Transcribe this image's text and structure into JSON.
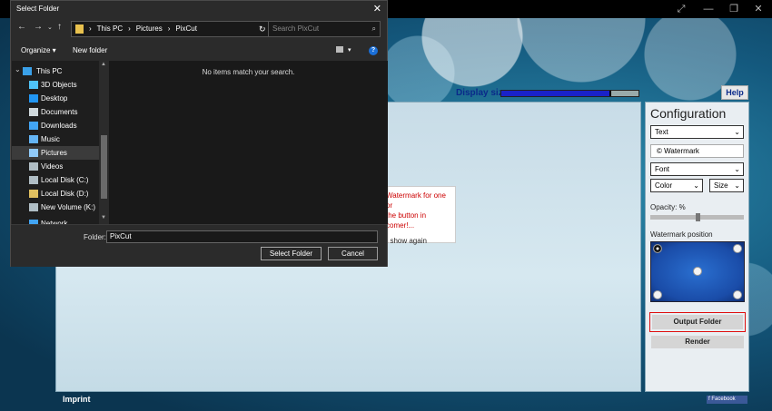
{
  "app": {
    "display_size_label": "Display size:",
    "display_size_value": 0.8,
    "help_label": "Help",
    "imprint_label": "Imprint",
    "facebook_label": "f Facebook",
    "notice": {
      "line1": "Watermark for one or",
      "line2": "the button in",
      "line3": "comer!...",
      "line4": "t show again"
    }
  },
  "config": {
    "title": "Configuration",
    "type_select": "Text",
    "watermark_text": "© Watermark",
    "font_select": "Font",
    "color_select": "Color",
    "size_select": "Size",
    "opacity_label": "Opacity: %",
    "opacity_value": 0.5,
    "position_label": "Watermark position",
    "output_folder_label": "Output Folder",
    "render_label": "Render"
  },
  "dialog": {
    "title": "Select Folder",
    "breadcrumb": [
      "This PC",
      "Pictures",
      "PixCut"
    ],
    "search_placeholder": "Search PixCut",
    "organize_label": "Organize ▾",
    "new_folder_label": "New folder",
    "nav_items": [
      {
        "label": "This PC",
        "icon": "computer-icon",
        "color": "#3aa0e8"
      },
      {
        "label": "3D Objects",
        "icon": "cube-icon",
        "color": "#4fc3f7"
      },
      {
        "label": "Desktop",
        "icon": "desktop-icon",
        "color": "#2196f3"
      },
      {
        "label": "Documents",
        "icon": "document-icon",
        "color": "#cfd8dc"
      },
      {
        "label": "Downloads",
        "icon": "download-icon",
        "color": "#42a5f5"
      },
      {
        "label": "Music",
        "icon": "music-icon",
        "color": "#64b5f6"
      },
      {
        "label": "Pictures",
        "icon": "picture-icon",
        "color": "#90caf9"
      },
      {
        "label": "Videos",
        "icon": "video-icon",
        "color": "#b0bec5"
      },
      {
        "label": "Local Disk (C:)",
        "icon": "drive-icon",
        "color": "#b0bec5"
      },
      {
        "label": "Local Disk (D:)",
        "icon": "drive-icon",
        "color": "#e0c060"
      },
      {
        "label": "New Volume (K:)",
        "icon": "drive-icon",
        "color": "#b0bec5"
      },
      {
        "label": "Network",
        "icon": "network-icon",
        "color": "#42a5f5"
      }
    ],
    "empty_message": "No items match your search.",
    "folder_label": "Folder:",
    "folder_value": "PixCut",
    "select_button": "Select Folder",
    "cancel_button": "Cancel"
  }
}
